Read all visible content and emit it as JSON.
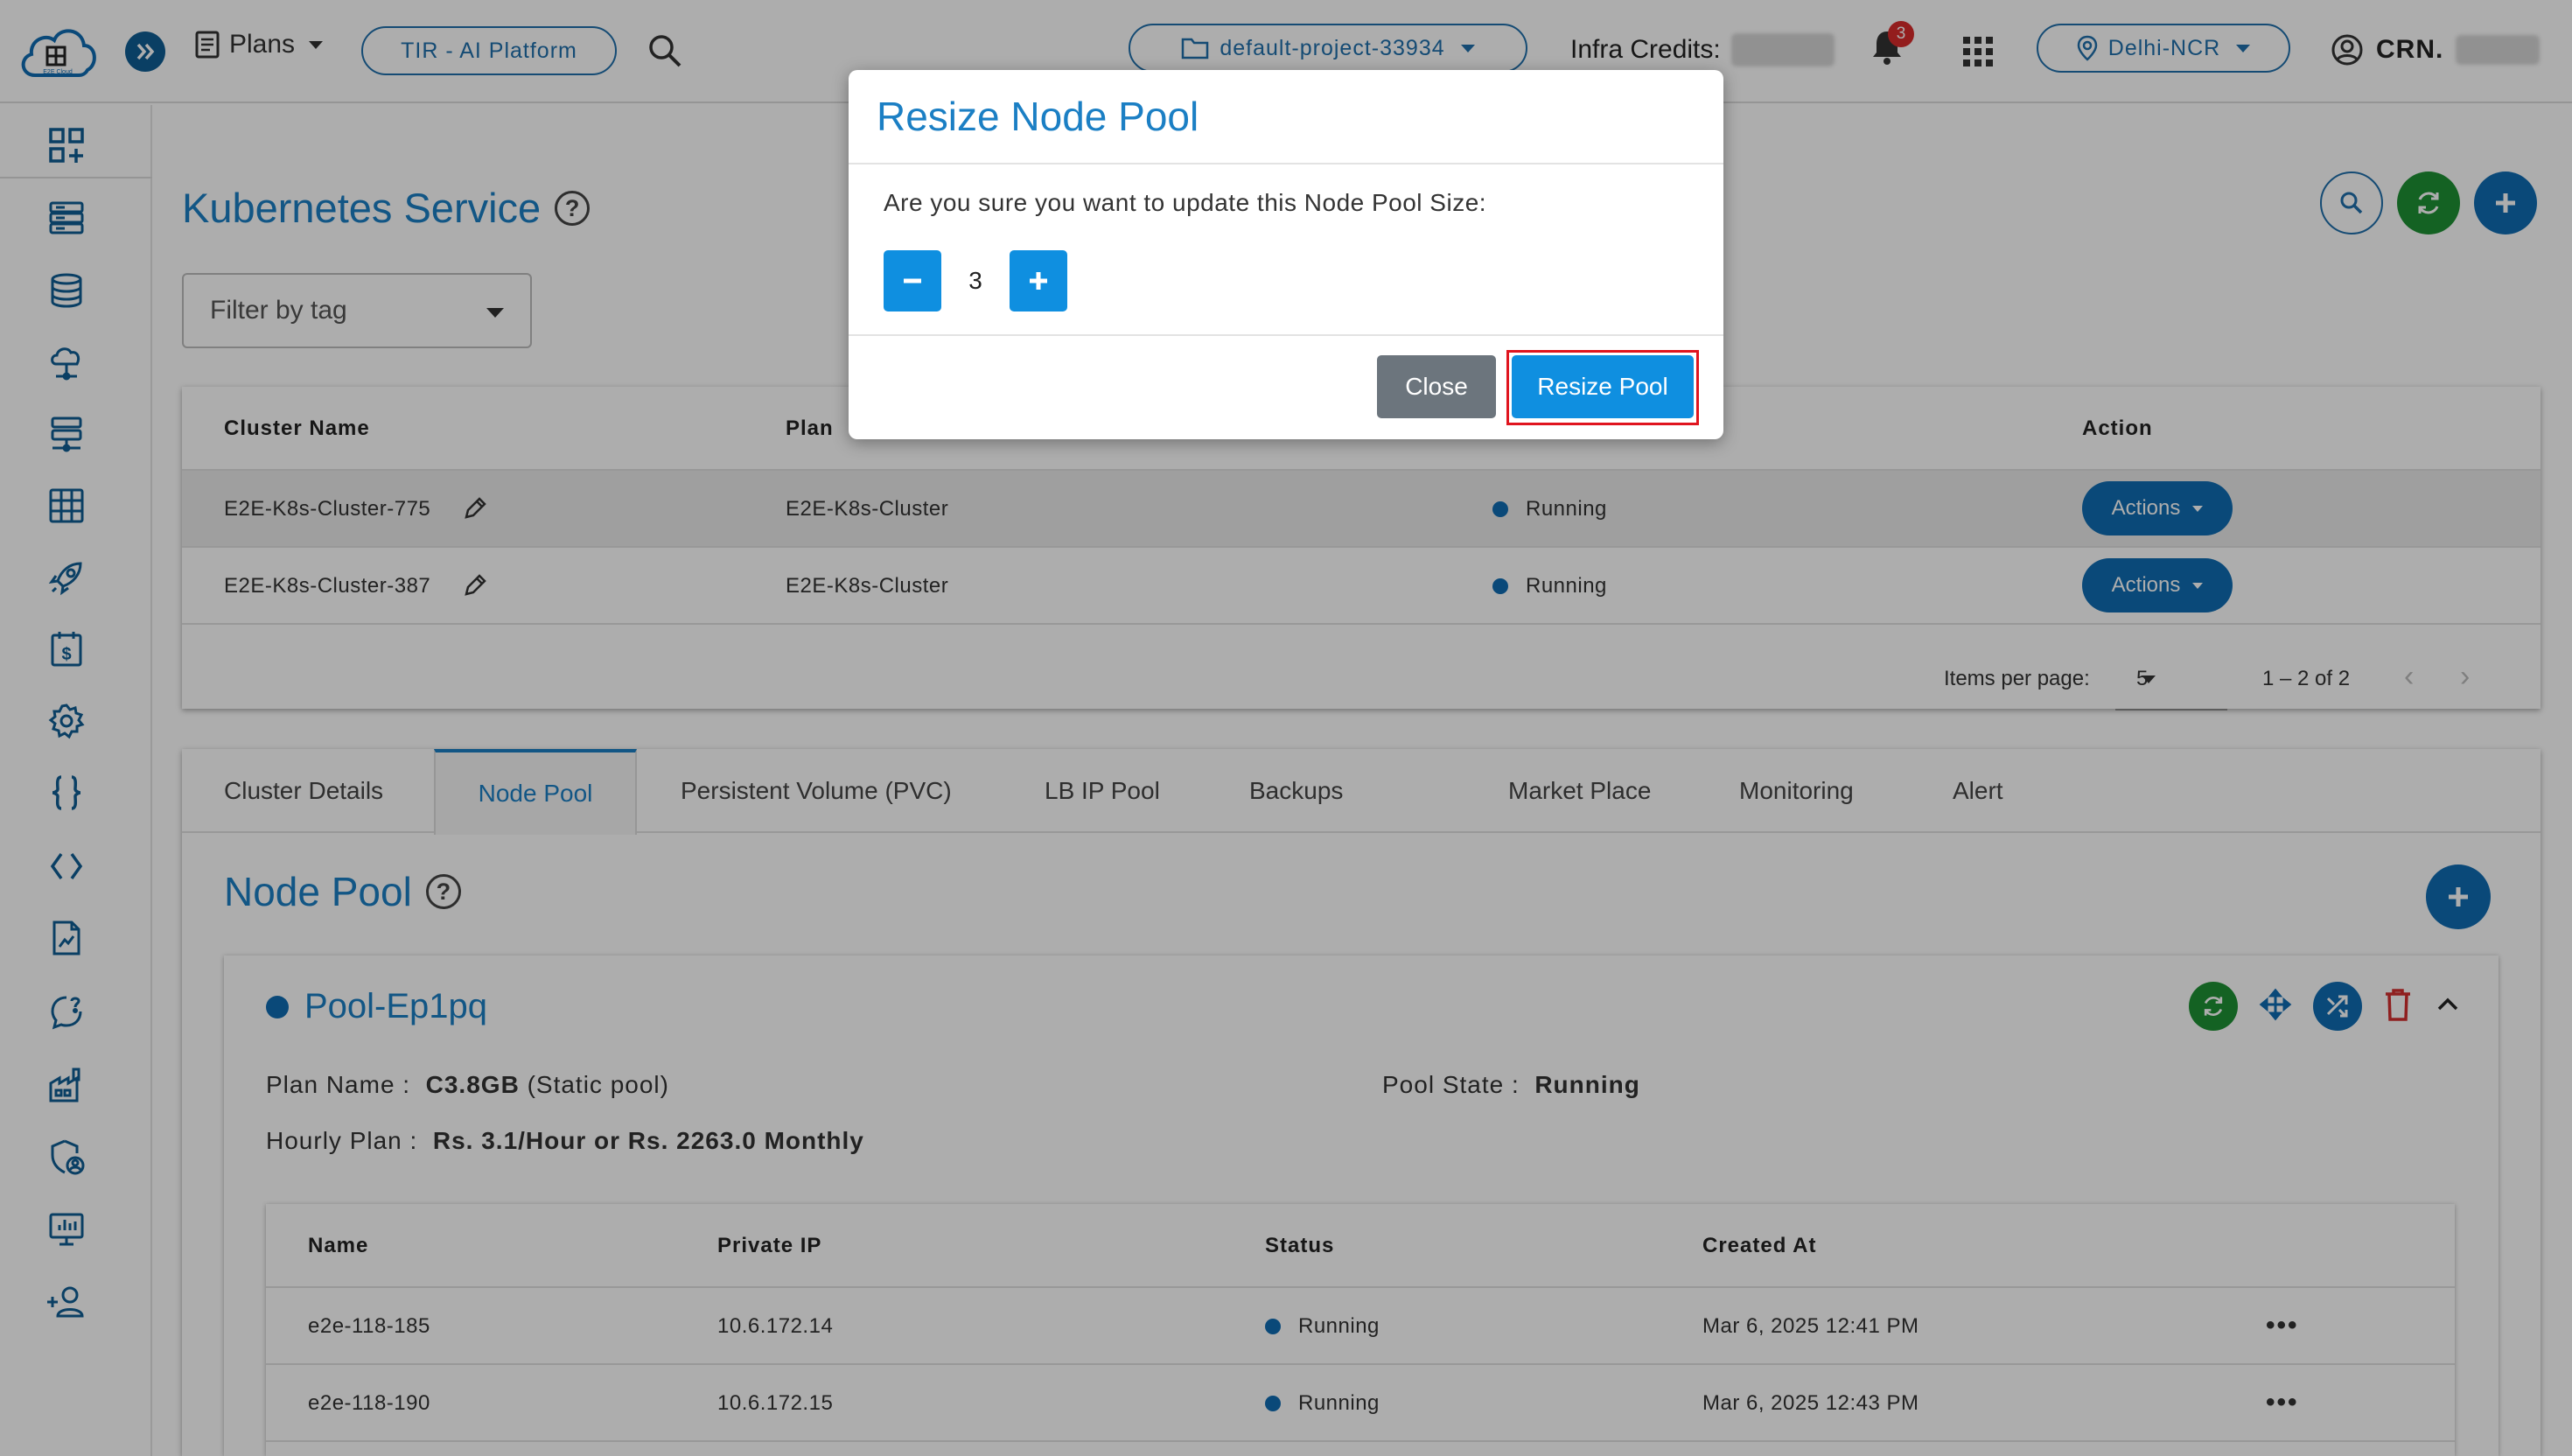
{
  "topbar": {
    "logo_text": "E2E Cloud",
    "plans_label": "Plans",
    "platform_pill": "TIR - AI Platform",
    "project": "default-project-33934",
    "infra_credits_label": "Infra Credits:",
    "notification_count": "3",
    "region": "Delhi-NCR",
    "crn_label": "CRN."
  },
  "sidebar": {
    "icons": [
      "dashboard-icon",
      "server-list-icon",
      "database-icon",
      "cloud-network-icon",
      "load-balancer-icon",
      "storage-grid-icon",
      "rocket-icon",
      "billing-icon",
      "settings-icon",
      "api-braces-icon",
      "code-icon",
      "document-icon",
      "support-chat-icon",
      "factory-icon",
      "security-shield-icon",
      "monitor-icon",
      "add-user-icon"
    ]
  },
  "page": {
    "title": "Kubernetes Service",
    "filter_placeholder": "Filter by tag"
  },
  "cluster_table": {
    "headers": {
      "name": "Cluster Name",
      "plan": "Plan",
      "action": "Action"
    },
    "rows": [
      {
        "name": "E2E-K8s-Cluster-775",
        "plan": "E2E-K8s-Cluster",
        "status": "Running",
        "action": "Actions"
      },
      {
        "name": "E2E-K8s-Cluster-387",
        "plan": "E2E-K8s-Cluster",
        "status": "Running",
        "action": "Actions"
      }
    ],
    "pager": {
      "label": "Items per page:",
      "per_page": "5",
      "range": "1 – 2 of 2"
    }
  },
  "tabs": [
    "Cluster Details",
    "Node Pool",
    "Persistent Volume (PVC)",
    "LB IP Pool",
    "Backups",
    "Market Place",
    "Monitoring",
    "Alert"
  ],
  "active_tab": "Node Pool",
  "node_pool": {
    "section_title": "Node Pool",
    "pool_name": "Pool-Ep1pq",
    "plan_name_label": "Plan Name :",
    "plan_name_value": "C3.8GB",
    "plan_name_note": "(Static pool)",
    "pool_state_label": "Pool State :",
    "pool_state_value": "Running",
    "hourly_plan_label": "Hourly Plan :",
    "hourly_plan_value": "Rs. 3.1/Hour or Rs. 2263.0 Monthly",
    "table": {
      "headers": {
        "name": "Name",
        "ip": "Private IP",
        "status": "Status",
        "created": "Created At"
      },
      "rows": [
        {
          "name": "e2e-118-185",
          "ip": "10.6.172.14",
          "status": "Running",
          "created": "Mar 6, 2025 12:41 PM",
          "more": "•••"
        },
        {
          "name": "e2e-118-190",
          "ip": "10.6.172.15",
          "status": "Running",
          "created": "Mar 6, 2025 12:43 PM",
          "more": "•••"
        }
      ]
    }
  },
  "modal": {
    "title": "Resize Node Pool",
    "message": "Are you sure you want to update this Node Pool Size:",
    "size_value": "3",
    "close_label": "Close",
    "resize_label": "Resize Pool"
  },
  "colors": {
    "brand_blue": "#1b7fc4",
    "button_blue": "#0f8fe0",
    "status_blue": "#0f6cb3",
    "refresh_green": "#1e9134",
    "delete_red": "#d32f2f",
    "highlight_red": "#e0151f",
    "close_grey": "#6c757d"
  }
}
